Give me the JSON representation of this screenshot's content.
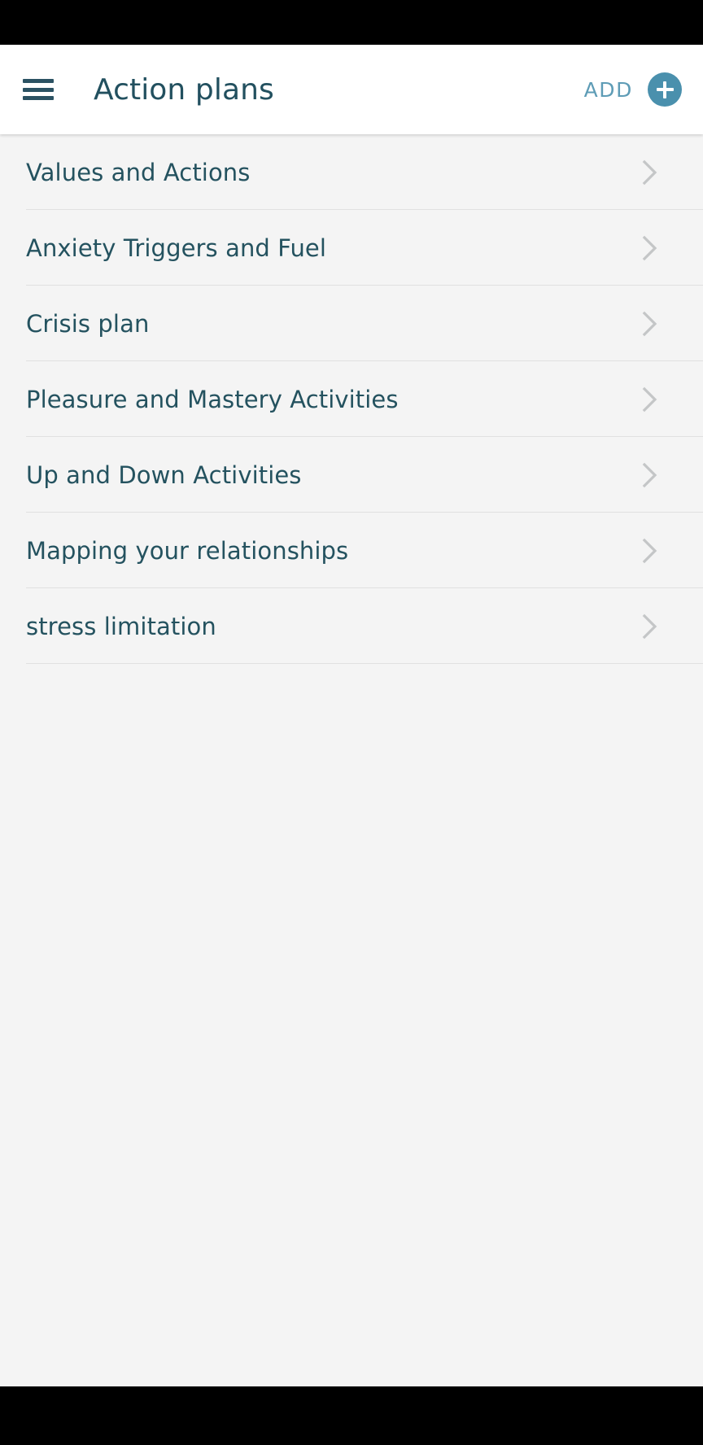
{
  "app": {
    "screen_title": "Action plans"
  },
  "app_bar": {
    "menu_icon": "hamburger-menu-icon",
    "title": "Action plans",
    "add_label": "ADD",
    "add_icon": "plus-icon"
  },
  "list": {
    "items": [
      {
        "label": "Values and Actions",
        "chevron": "chevron-right-icon"
      },
      {
        "label": "Anxiety Triggers and Fuel",
        "chevron": "chevron-right-icon"
      },
      {
        "label": "Crisis plan",
        "chevron": "chevron-right-icon"
      },
      {
        "label": "Pleasure and Mastery Activities",
        "chevron": "chevron-right-icon"
      },
      {
        "label": "Up and Down Activities",
        "chevron": "chevron-right-icon"
      },
      {
        "label": "Mapping your relationships",
        "chevron": "chevron-right-icon"
      },
      {
        "label": "stress limitation",
        "chevron": "chevron-right-icon"
      }
    ]
  },
  "colors": {
    "title_text": "#22505f",
    "item_text": "#24525f",
    "add_label": "#5e9cb6",
    "fab_background": "#4a90ad",
    "app_bar_background": "#ffffff",
    "page_background": "#f4f4f4",
    "divider": "#e0e0e0",
    "system_bar": "#000000",
    "chevron": "#c4c6c7"
  }
}
